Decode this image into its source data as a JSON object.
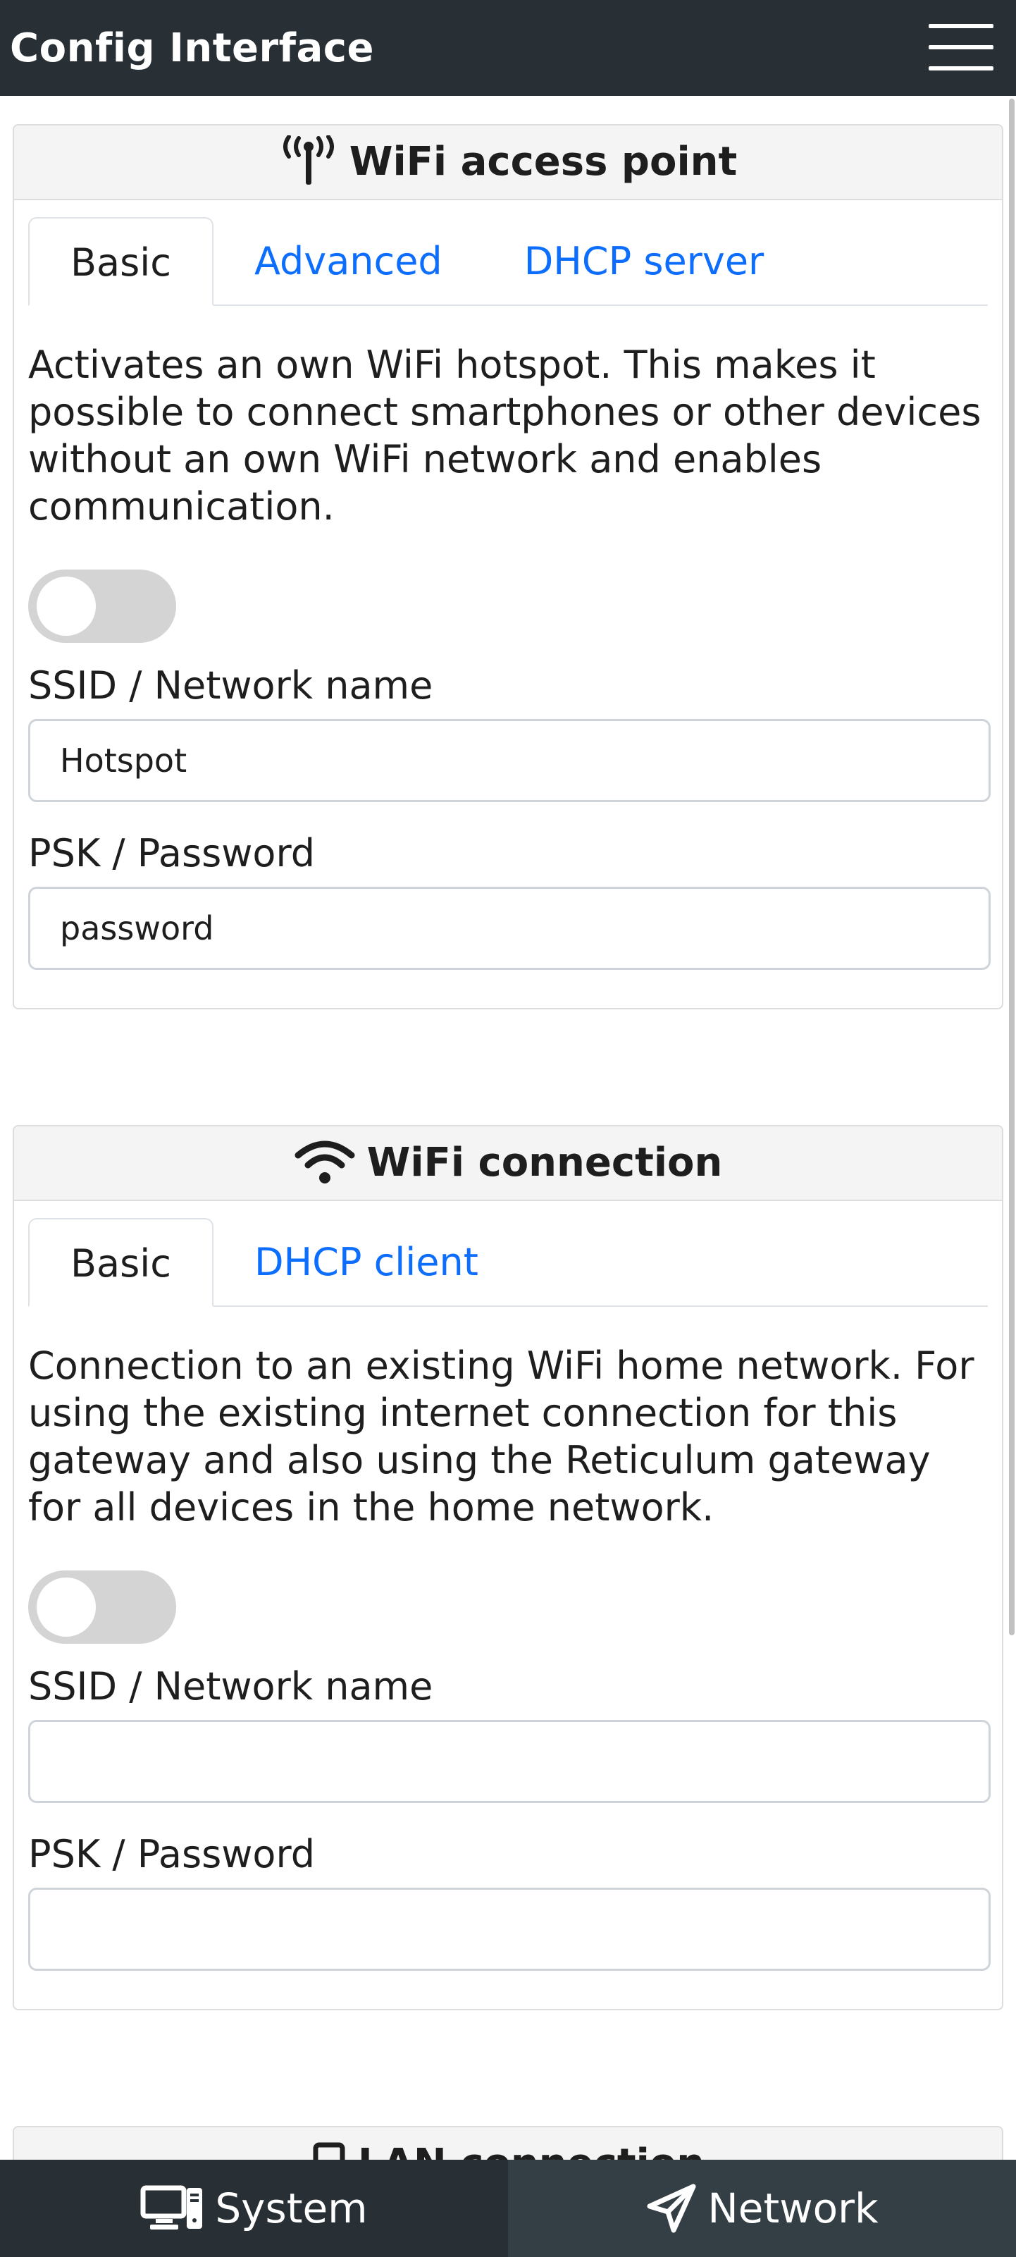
{
  "header": {
    "title": "Config Interface",
    "menu_icon": "hamburger-menu-icon"
  },
  "access_point": {
    "icon": "antenna-broadcast-icon",
    "title": "WiFi access point",
    "tabs": [
      "Basic",
      "Advanced",
      "DHCP server"
    ],
    "active_tab": "Basic",
    "description": "Activates an own WiFi hotspot. This makes it possible to connect smartphones or other devices without an own WiFi network and enables communication.",
    "enabled": false,
    "ssid_label": "SSID / Network name",
    "ssid_value": "Hotspot",
    "psk_label": "PSK / Password",
    "psk_value": "password"
  },
  "wifi_connection": {
    "icon": "wifi-icon",
    "title": "WiFi connection",
    "tabs": [
      "Basic",
      "DHCP client"
    ],
    "active_tab": "Basic",
    "description": "Connection to an existing WiFi home network. For using the existing internet connection for this gateway and also using the Reticulum gateway for all devices in the home network.",
    "enabled": false,
    "ssid_label": "SSID / Network name",
    "ssid_value": "",
    "psk_label": "PSK / Password",
    "psk_value": ""
  },
  "lan_connection": {
    "icon": "ethernet-icon",
    "title": "LAN connection"
  },
  "bottom_nav": {
    "system_label": "System",
    "system_icon": "desktop-computer-icon",
    "network_label": "Network",
    "network_icon": "paper-plane-icon",
    "active": "Network"
  },
  "colors": {
    "topbar": "#283035",
    "nav_system": "#283035",
    "nav_network": "#343f45",
    "link": "#0d6efd",
    "toggle_off": "#d4d4d4"
  }
}
